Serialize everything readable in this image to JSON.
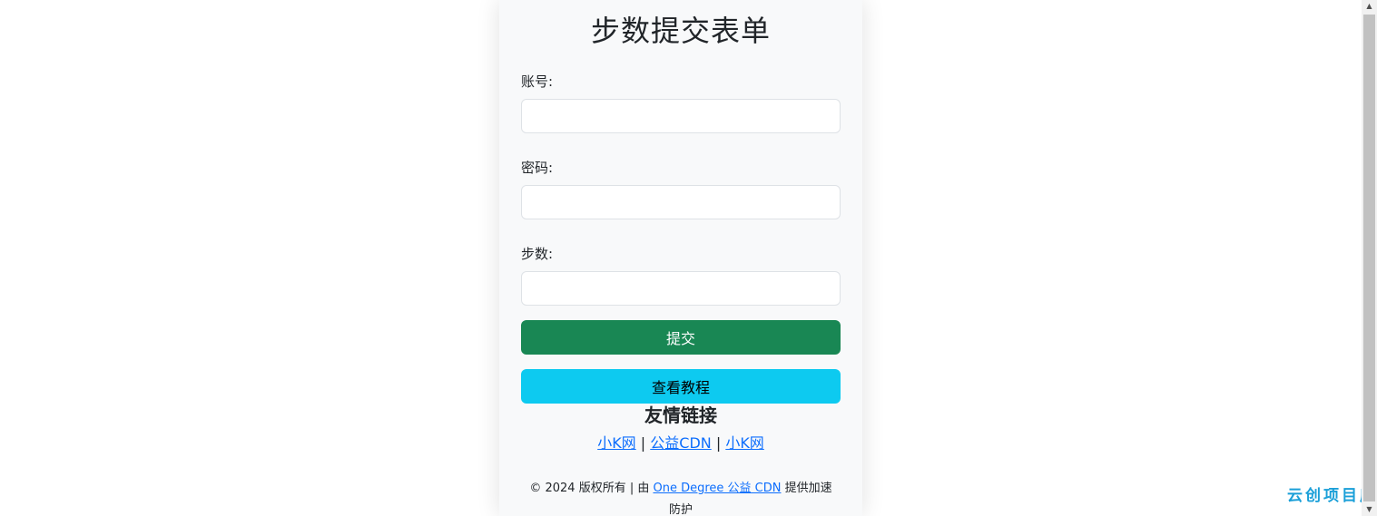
{
  "form": {
    "title": "步数提交表单",
    "account_label": "账号:",
    "password_label": "密码:",
    "steps_label": "步数:",
    "account_value": "",
    "password_value": "",
    "steps_value": "",
    "submit_label": "提交",
    "tutorial_label": "查看教程"
  },
  "friends": {
    "title": "友情链接",
    "links": [
      "小K网",
      "公益CDN",
      "小K网"
    ],
    "separator": "|"
  },
  "footer": {
    "prefix": "© 2024 版权所有 | 由",
    "link_text": "One Degree 公益 CDN",
    "suffix": "提供加速防护"
  },
  "watermark": "云创项目库",
  "colors": {
    "submit_bg": "#198754",
    "tutorial_bg": "#0dcaf0",
    "link": "#0d6efd",
    "card_bg": "#f8f9fa"
  },
  "icons": {
    "scroll_up": "triangle-up",
    "scroll_down": "triangle-down"
  }
}
